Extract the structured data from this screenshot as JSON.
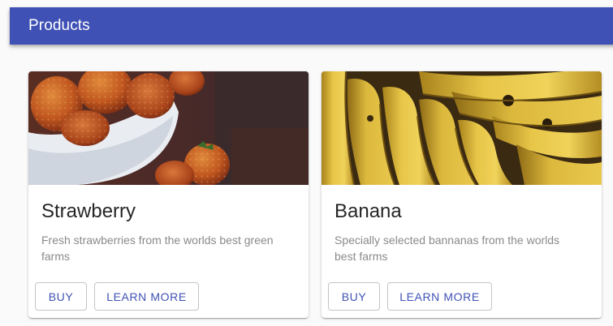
{
  "appbar": {
    "title": "Products",
    "color": "#3f51b5"
  },
  "products": [
    {
      "name": "Strawberry",
      "description": "Fresh strawberries from the worlds best green farms",
      "image_alt": "strawberries in a white bowl",
      "buy_label": "Buy",
      "learn_more_label": "Learn More"
    },
    {
      "name": "Banana",
      "description": "Specially selected bannanas from the worlds best farms",
      "image_alt": "bunch of bananas",
      "buy_label": "Buy",
      "learn_more_label": "Learn More"
    }
  ]
}
